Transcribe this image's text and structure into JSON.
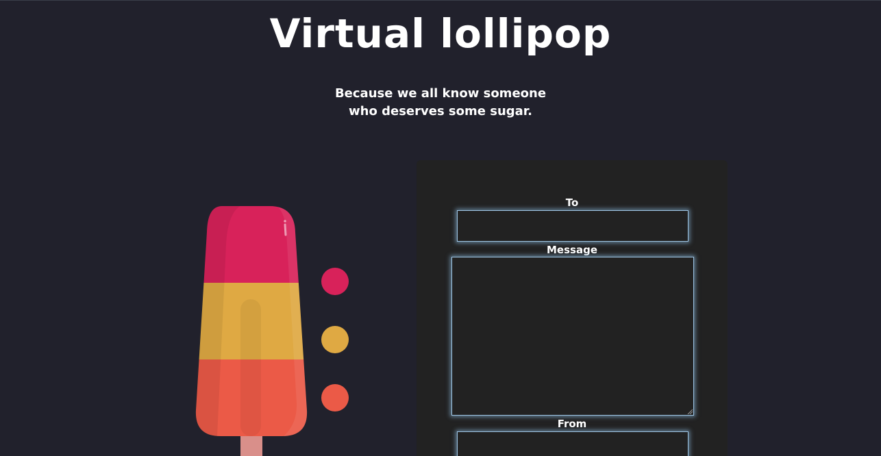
{
  "header": {
    "title": "Virtual lollipop",
    "subtitle_line1": "Because we all know someone",
    "subtitle_line2": "who deserves some sugar."
  },
  "popsicle": {
    "layers": [
      {
        "name": "top-layer",
        "color": "#d8225a"
      },
      {
        "name": "middle-layer",
        "color": "#dfa943"
      },
      {
        "name": "bottom-layer",
        "color": "#eb5a47"
      }
    ],
    "stick_color": "#d98f8a"
  },
  "color_picker": {
    "swatches": [
      {
        "name": "swatch-pink",
        "color": "#d8225a"
      },
      {
        "name": "swatch-yellow",
        "color": "#dfa943"
      },
      {
        "name": "swatch-orange",
        "color": "#eb5a47"
      }
    ]
  },
  "form": {
    "to_label": "To",
    "to_value": "",
    "message_label": "Message",
    "message_value": "",
    "from_label": "From",
    "from_value": ""
  }
}
